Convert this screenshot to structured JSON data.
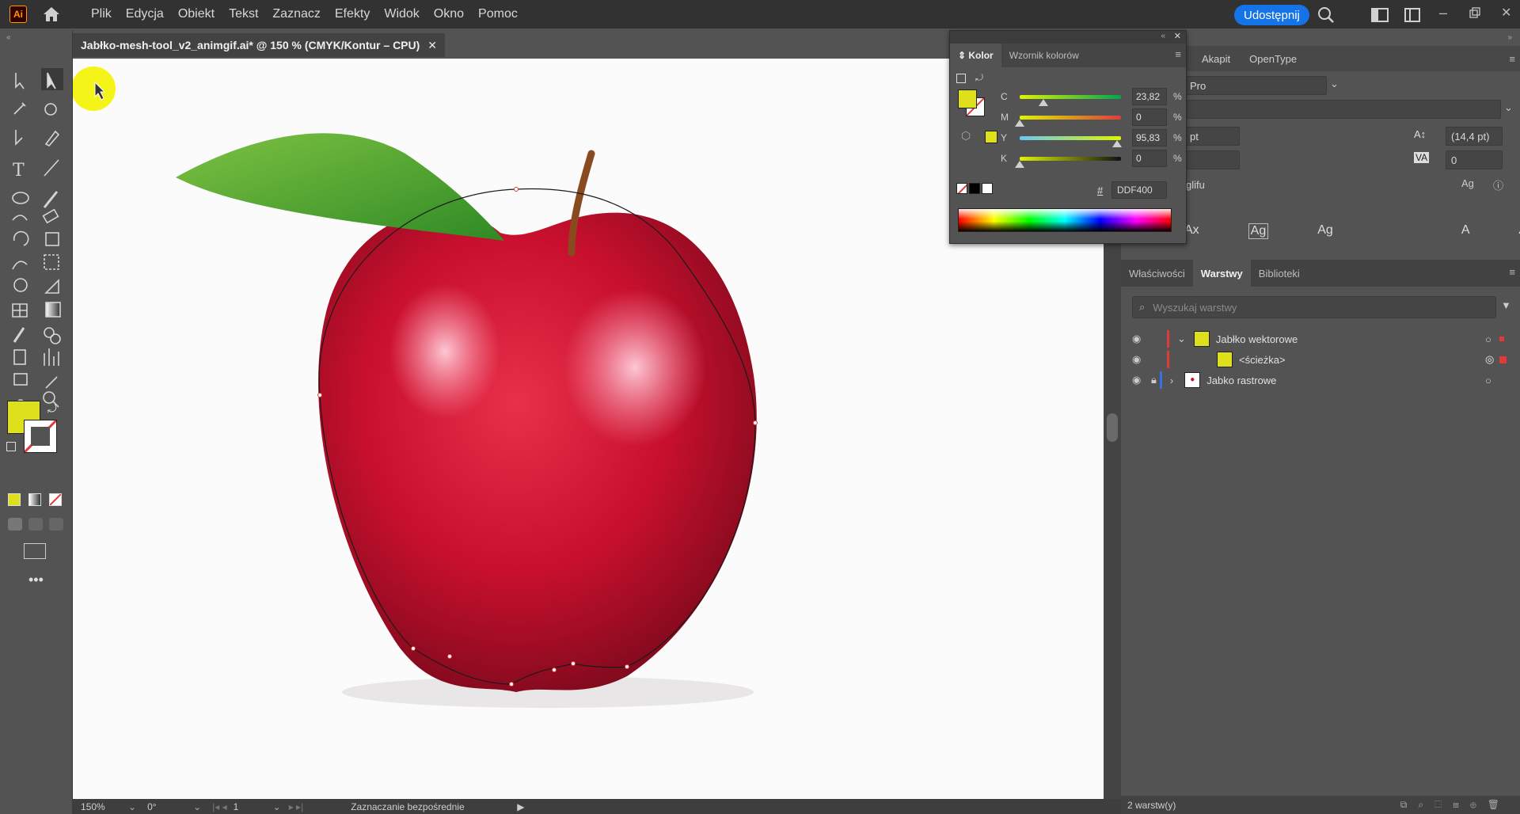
{
  "app": {
    "logo": "Ai",
    "share_label": "Udostępnij"
  },
  "menu": [
    "Plik",
    "Edycja",
    "Obiekt",
    "Tekst",
    "Zaznacz",
    "Efekty",
    "Widok",
    "Okno",
    "Pomoc"
  ],
  "document": {
    "tab_title": "Jabłko-mesh-tool_v2_animgif.ai* @ 150 % (CMYK/Kontur – CPU)",
    "close": "✕"
  },
  "status": {
    "zoom": "150%",
    "rotation": "0°",
    "artboard": "1",
    "tool": "Zaznaczanie bezpośrednie"
  },
  "color_panel": {
    "tabs": [
      "Kolor",
      "Wzornik kolorów"
    ],
    "sliders": [
      {
        "label": "C",
        "value": "23,82",
        "fraction": 0.2382
      },
      {
        "label": "M",
        "value": "0",
        "fraction": 0.0
      },
      {
        "label": "Y",
        "value": "95,83",
        "fraction": 0.9583
      },
      {
        "label": "K",
        "value": "0",
        "fraction": 0.0
      }
    ],
    "percent": "%",
    "hex_symbol": "#",
    "hex": "DDF400",
    "fill_color": "#DDE01A"
  },
  "character": {
    "tabs": [
      "Akapit",
      "OpenType"
    ],
    "font_family": "Pro",
    "leading": "(14,4 pt)",
    "tracking": "0",
    "unit": "pt",
    "glyph_label": "glifu"
  },
  "layers_panel": {
    "tabs": [
      "Właściwości",
      "Warstwy",
      "Biblioteki"
    ],
    "search_placeholder": "Wyszukaj warstwy",
    "layers": [
      {
        "name": "Jabłko wektorowe"
      },
      {
        "name": "<ścieżka>"
      },
      {
        "name": "Jabko rastrowe"
      }
    ],
    "footer": "2 warstw(y)"
  },
  "colors": {
    "accent": "#1473e6",
    "selection": "#e03a3a",
    "fill": "#DDE01A"
  }
}
